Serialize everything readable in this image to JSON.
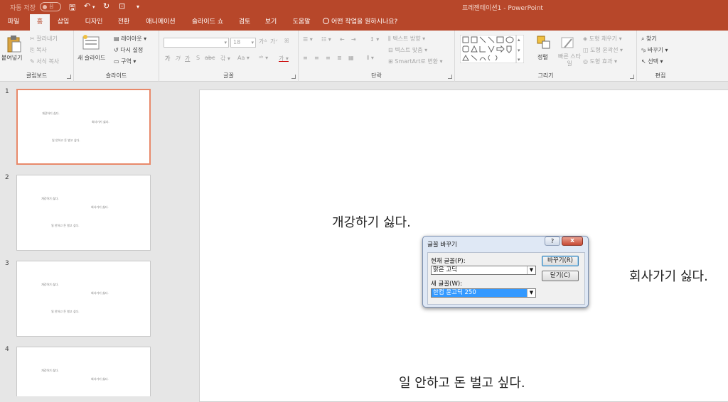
{
  "titlebar": {
    "autosave_label": "자동 저장",
    "autosave_state": "끔",
    "title": "프레젠테이션1  -  PowerPoint"
  },
  "tabs": [
    "파일",
    "홈",
    "삽입",
    "디자인",
    "전환",
    "애니메이션",
    "슬라이드 쇼",
    "검토",
    "보기",
    "도움말"
  ],
  "tell_me": "어떤 작업을 원하시나요?",
  "ribbon": {
    "clipboard": {
      "paste": "붙여넣기",
      "cut": "잘라내기",
      "copy": "복사",
      "format_painter": "서식 복사",
      "label": "클립보드"
    },
    "slides": {
      "new_slide": "새 슬라이드",
      "layout": "레이아웃",
      "reset": "다시 설정",
      "section": "구역",
      "label": "슬라이드"
    },
    "font": {
      "font_size": "18",
      "label": "글꼴"
    },
    "paragraph": {
      "text_direction": "텍스트 방향",
      "align_text": "텍스트 맞춤",
      "smartart": "SmartArt로 변환",
      "label": "단락"
    },
    "drawing": {
      "arrange": "정렬",
      "quick_styles": "빠른 스타일",
      "fill": "도형 채우기",
      "outline": "도형 윤곽선",
      "effects": "도형 효과",
      "label": "그리기"
    },
    "editing": {
      "find": "찾기",
      "replace": "바꾸기",
      "select": "선택",
      "label": "편집"
    }
  },
  "slides": [
    {
      "num": "1",
      "texts": [
        "개강하기 싫다.",
        "회사가기 싫다.",
        "일 안하고 돈 벌고 싶다."
      ]
    },
    {
      "num": "2",
      "texts": [
        "개강하기 싫다.",
        "회사가기 싫다.",
        "일 안하고 돈 벌고 싶다."
      ]
    },
    {
      "num": "3",
      "texts": [
        "개강하기 싫다.",
        "회사가기 싫다.",
        "일 안하고 돈 벌고 싶다."
      ]
    },
    {
      "num": "4",
      "texts": [
        "개강하기 싫다.",
        "회사가기 싫다."
      ]
    }
  ],
  "main_slide": {
    "text1": "개강하기 싫다.",
    "text2": "회사가기 싫다.",
    "text3": "일 안하고 돈 벌고 싶다."
  },
  "dialog": {
    "title": "글꼴 바꾸기",
    "current_label": "현재 글꼴(P):",
    "current_value": "맑은 고딕",
    "new_label": "새 글꼴(W):",
    "new_value": "한컴 윤고딕 250",
    "replace_button": "바꾸기(R)",
    "close_button": "닫기(C)",
    "help": "?",
    "close_x": "x"
  },
  "colors": {
    "accent": "#b7472a",
    "selection": "#3399ff"
  }
}
